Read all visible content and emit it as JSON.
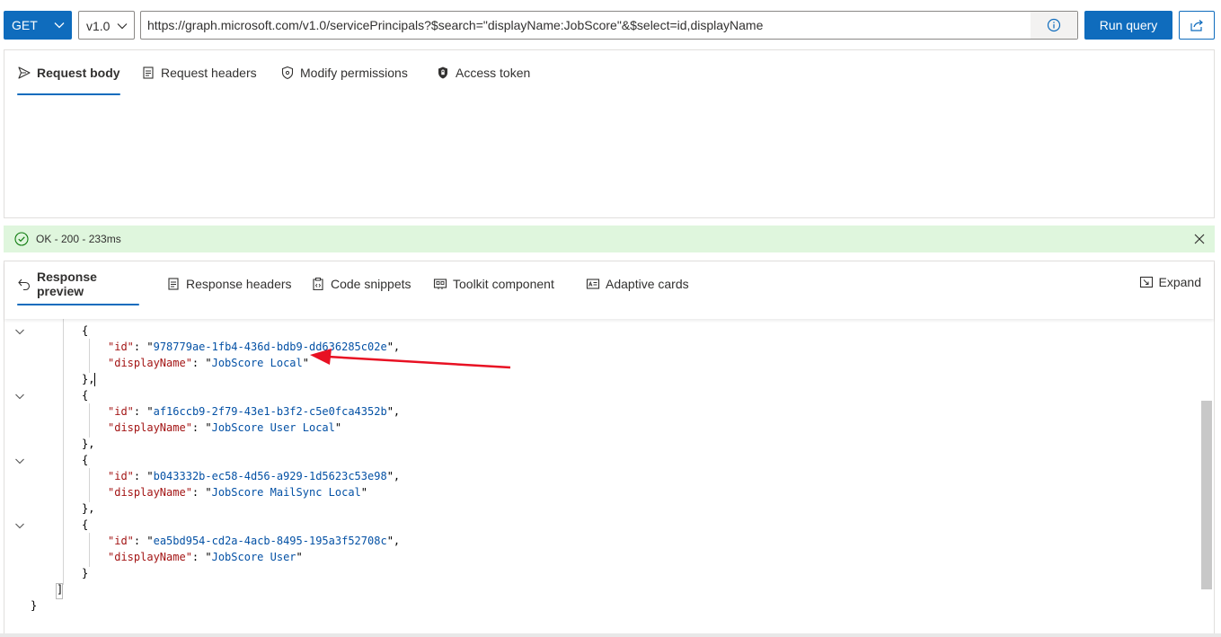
{
  "query": {
    "method": "GET",
    "version": "v1.0",
    "url": "https://graph.microsoft.com/v1.0/servicePrincipals?$search=\"displayName:JobScore\"&$select=id,displayName",
    "run_label": "Run query"
  },
  "request_tabs": [
    {
      "label": "Request body",
      "icon": "send-icon",
      "active": true
    },
    {
      "label": "Request headers",
      "icon": "document-icon",
      "active": false
    },
    {
      "label": "Modify permissions",
      "icon": "shield-icon",
      "active": false
    },
    {
      "label": "Access token",
      "icon": "lock-icon",
      "active": false
    }
  ],
  "status": {
    "text": "OK - 200 - 233ms",
    "color": "#dff6dd"
  },
  "response_tabs": [
    {
      "label": "Response preview",
      "icon": "undo-arrow-icon",
      "active": true
    },
    {
      "label": "Response headers",
      "icon": "document-icon",
      "active": false
    },
    {
      "label": "Code snippets",
      "icon": "code-clipboard-icon",
      "active": false
    },
    {
      "label": "Toolkit component",
      "icon": "toolkit-icon",
      "active": false
    },
    {
      "label": "Adaptive cards",
      "icon": "card-icon",
      "active": false
    }
  ],
  "expand_label": "Expand",
  "response": {
    "items": [
      {
        "id": "978779ae-1fb4-436d-bdb9-dd636285c02e",
        "displayName": "JobScore Local"
      },
      {
        "id": "af16ccb9-2f79-43e1-b3f2-c5e0fca4352b",
        "displayName": "JobScore User Local"
      },
      {
        "id": "b043332b-ec58-4d56-a929-1d5623c53e98",
        "displayName": "JobScore MailSync Local"
      },
      {
        "id": "ea5bd954-cd2a-4acb-8495-195a3f52708c",
        "displayName": "JobScore User"
      }
    ],
    "keys": {
      "id": "\"id\"",
      "displayName": "\"displayName\""
    }
  },
  "annotation": {
    "color": "#e81123"
  },
  "colors": {
    "accent": "#0f6cbd",
    "key": "#a31515",
    "string": "#0451a5"
  }
}
